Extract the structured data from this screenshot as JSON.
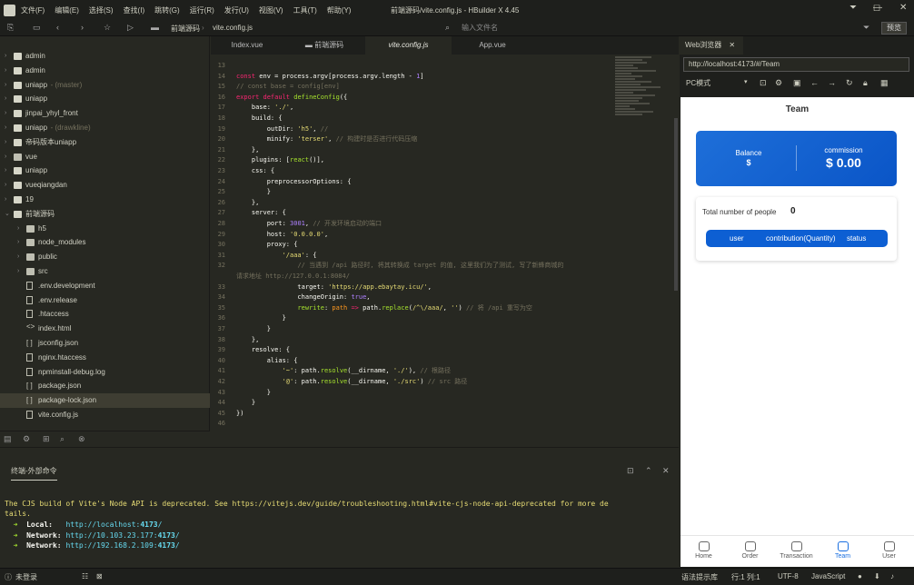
{
  "app": {
    "menu": [
      "文件(F)",
      "编辑(E)",
      "选择(S)",
      "查找(I)",
      "跳转(G)",
      "运行(R)",
      "发行(U)",
      "视图(V)",
      "工具(T)",
      "帮助(Y)"
    ],
    "title": "前端源码/vite.config.js - HBuilder X 4.45"
  },
  "toolbar": {
    "breadcrumb_project": "前端源码",
    "breadcrumb_file": "vite.config.js",
    "search_placeholder": "输入文件名",
    "preview_label": "预览"
  },
  "sidebar": {
    "items": [
      {
        "label": "admin",
        "extra": "",
        "type": "uni",
        "depth": 0,
        "open": false,
        "selected": false
      },
      {
        "label": "admin",
        "extra": "",
        "type": "uni",
        "depth": 0,
        "open": false,
        "selected": false
      },
      {
        "label": "uniapp",
        "extra": " - (master)",
        "type": "uni",
        "depth": 0,
        "open": false,
        "selected": false
      },
      {
        "label": "uniapp",
        "extra": "",
        "type": "uni",
        "depth": 0,
        "open": false,
        "selected": false
      },
      {
        "label": "jinpai_yhyl_front",
        "extra": "",
        "type": "uni",
        "depth": 0,
        "open": false,
        "selected": false
      },
      {
        "label": "uniapp",
        "extra": " - (drawkline)",
        "type": "uni",
        "depth": 0,
        "open": false,
        "selected": false
      },
      {
        "label": "帝码版本uniapp",
        "extra": "",
        "type": "uni",
        "depth": 0,
        "open": false,
        "selected": false
      },
      {
        "label": "vue",
        "extra": "",
        "type": "folder",
        "depth": 0,
        "open": false,
        "selected": false
      },
      {
        "label": "uniapp",
        "extra": "",
        "type": "uni",
        "depth": 0,
        "open": false,
        "selected": false
      },
      {
        "label": "vueqiangdan",
        "extra": "",
        "type": "uni",
        "depth": 0,
        "open": false,
        "selected": false
      },
      {
        "label": "19",
        "extra": "",
        "type": "uni",
        "depth": 0,
        "open": false,
        "selected": false
      },
      {
        "label": "前端源码",
        "extra": "",
        "type": "uni",
        "depth": 0,
        "open": true,
        "selected": false
      },
      {
        "label": "h5",
        "extra": "",
        "type": "folder",
        "depth": 1,
        "open": false,
        "selected": false
      },
      {
        "label": "node_modules",
        "extra": "",
        "type": "folder",
        "depth": 1,
        "open": false,
        "selected": false
      },
      {
        "label": "public",
        "extra": "",
        "type": "folder",
        "depth": 1,
        "open": false,
        "selected": false
      },
      {
        "label": "src",
        "extra": "",
        "type": "folder",
        "depth": 1,
        "open": false,
        "selected": false
      },
      {
        "label": ".env.development",
        "extra": "",
        "type": "file",
        "depth": 1,
        "open": null,
        "selected": false
      },
      {
        "label": ".env.release",
        "extra": "",
        "type": "file",
        "depth": 1,
        "open": null,
        "selected": false
      },
      {
        "label": ".htaccess",
        "extra": "",
        "type": "file",
        "depth": 1,
        "open": null,
        "selected": false
      },
      {
        "label": "index.html",
        "extra": "",
        "type": "code",
        "depth": 1,
        "open": null,
        "selected": false
      },
      {
        "label": "jsconfig.json",
        "extra": "",
        "type": "json",
        "depth": 1,
        "open": null,
        "selected": false
      },
      {
        "label": "nginx.htaccess",
        "extra": "",
        "type": "file",
        "depth": 1,
        "open": null,
        "selected": false
      },
      {
        "label": "npminstall-debug.log",
        "extra": "",
        "type": "file",
        "depth": 1,
        "open": null,
        "selected": false
      },
      {
        "label": "package.json",
        "extra": "",
        "type": "json",
        "depth": 1,
        "open": null,
        "selected": false
      },
      {
        "label": "package-lock.json",
        "extra": "",
        "type": "json",
        "depth": 1,
        "open": null,
        "selected": true
      },
      {
        "label": "vite.config.js",
        "extra": "",
        "type": "file",
        "depth": 1,
        "open": null,
        "selected": false
      }
    ]
  },
  "tabs": [
    {
      "label": "Index.vue",
      "active": false
    },
    {
      "label": "前端源码",
      "active": false
    },
    {
      "label": "vite.config.js",
      "active": true
    },
    {
      "label": "App.vue",
      "active": false
    }
  ],
  "editor": {
    "lines": [
      {
        "n": "13",
        "html": ""
      },
      {
        "n": "14",
        "html": "<span class='k'>const</span> env = process.argv[process.argv.length - <span class='n'>1</span>]"
      },
      {
        "n": "15",
        "html": "<span class='c'>// const base = config[env]</span>"
      },
      {
        "n": "16",
        "html": "<span class='k'>export default</span> <span class='i'>defineConfig</span>({"
      },
      {
        "n": "17",
        "html": "    base: <span class='s'>'./'</span>,"
      },
      {
        "n": "18",
        "html": "    build: {"
      },
      {
        "n": "19",
        "html": "        outDir: <span class='s'>'h5'</span>, <span class='c'>//</span>"
      },
      {
        "n": "20",
        "html": "        minify: <span class='s'>'terser'</span>, <span class='c'>// 构建时是否进行代码压缩</span>"
      },
      {
        "n": "21",
        "html": "    },"
      },
      {
        "n": "22",
        "html": "    plugins: [<span class='i'>react</span>()],"
      },
      {
        "n": "23",
        "html": "    css: {"
      },
      {
        "n": "24",
        "html": "        preprocessorOptions: {"
      },
      {
        "n": "25",
        "html": "        }"
      },
      {
        "n": "26",
        "html": "    },"
      },
      {
        "n": "27",
        "html": "    server: {"
      },
      {
        "n": "28",
        "html": "        port: <span class='n'>3001</span>, <span class='c'>// 开发环境启动的端口</span>"
      },
      {
        "n": "29",
        "html": "        host: <span class='s'>'0.0.0.0'</span>,"
      },
      {
        "n": "30",
        "html": "        proxy: {"
      },
      {
        "n": "31",
        "html": "            <span class='s'>'/aaa'</span>: {"
      },
      {
        "n": "32",
        "html": "                <span class='c'>// 当遇到 /api 路径时, 将其转换成 target 的值, 这里我们为了测试, 写了新蜂商城的</span>"
      },
      {
        "n": "",
        "html": "<span class='c'>请求地址 http://127.0.0.1:8084/</span>"
      },
      {
        "n": "33",
        "html": "                target: <span class='s'>'https://app.ebaytay.icu/'</span>,"
      },
      {
        "n": "34",
        "html": "                changeOrigin: <span class='n'>true</span>,"
      },
      {
        "n": "35",
        "html": "                <span class='i'>rewrite</span>: <span class='v'>path</span> <span class='k'>=&gt;</span> path.<span class='i'>replace</span>(<span class='s'>/^\\/aaa/</span>, <span class='s'>''</span>) <span class='c'>// 将 /api 重写为空</span>"
      },
      {
        "n": "36",
        "html": "            }"
      },
      {
        "n": "37",
        "html": "        }"
      },
      {
        "n": "38",
        "html": "    },"
      },
      {
        "n": "39",
        "html": "    resolve: {"
      },
      {
        "n": "40",
        "html": "        alias: {"
      },
      {
        "n": "41",
        "html": "            <span class='s'>'~'</span>: path.<span class='i'>resolve</span>(__dirname, <span class='s'>'./'</span>), <span class='c'>// 根路径</span>"
      },
      {
        "n": "42",
        "html": "            <span class='s'>'@'</span>: path.<span class='i'>resolve</span>(__dirname, <span class='s'>'./src'</span>) <span class='c'>// src 路径</span>"
      },
      {
        "n": "43",
        "html": "        }"
      },
      {
        "n": "44",
        "html": "    }"
      },
      {
        "n": "45",
        "html": "})"
      },
      {
        "n": "46",
        "html": ""
      }
    ]
  },
  "terminal": {
    "tab_label": "终端-外部命令",
    "warn_line1": "The CJS build of Vite's Node API is deprecated. See https://vitejs.dev/guide/troubleshooting.html#vite-cjs-node-api-deprecated for more de",
    "warn_line2": "tails.",
    "local_label": "Local:",
    "local_url": "http://localhost:",
    "local_port": "4173",
    "network1_label": "Network:",
    "network1_url": "http://10.103.23.177:",
    "network1_port": "4173",
    "network2_label": "Network:",
    "network2_url": "http://192.168.2.109:",
    "network2_port": "4173",
    "slash": "/"
  },
  "browser": {
    "tab_label": "Web浏览器",
    "url": "http://localhost:4173/#/Team",
    "device": "PC模式"
  },
  "phone": {
    "title": "Team",
    "balance_label": "Balance",
    "balance_value": "$",
    "commission_label": "commission",
    "commission_value": "$ 0.00",
    "total_label": "Total number of people",
    "total_value": "0",
    "col_user": "user",
    "col_contrib": "contribution(Quantity)",
    "col_status": "status",
    "nav": [
      {
        "label": "Home",
        "active": false
      },
      {
        "label": "Order",
        "active": false
      },
      {
        "label": "Transaction",
        "active": false
      },
      {
        "label": "Team",
        "active": true
      },
      {
        "label": "User",
        "active": false
      }
    ]
  },
  "status": {
    "login": "未登录",
    "hint": "语法提示库",
    "position": "行:1  列:1",
    "encoding": "UTF-8",
    "language": "JavaScript"
  }
}
